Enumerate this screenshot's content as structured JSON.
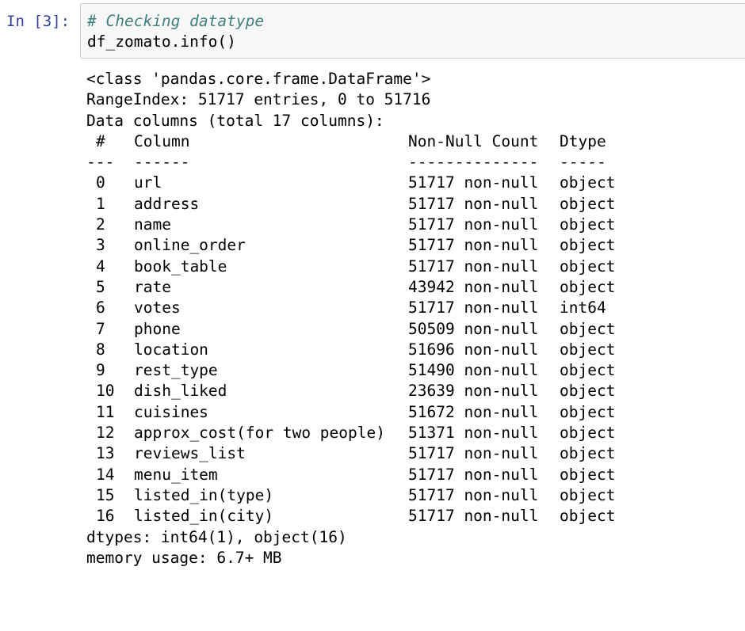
{
  "cell": {
    "prompt": "In [3]:",
    "code": {
      "comment": "# Checking datatype",
      "call": "df_zomato.info()"
    }
  },
  "output": {
    "class_line": "<class 'pandas.core.frame.DataFrame'>",
    "range_index": "RangeIndex: 51717 entries, 0 to 51716",
    "data_columns": "Data columns (total 17 columns):",
    "headers": {
      "index": "#",
      "column": "Column",
      "count": "Non-Null Count",
      "dtype": "Dtype"
    },
    "separators": {
      "index": "---",
      "column": "------",
      "count": "--------------",
      "dtype": "-----"
    },
    "rows": [
      {
        "index": "0",
        "column": "url",
        "count": "51717 non-null",
        "dtype": "object"
      },
      {
        "index": "1",
        "column": "address",
        "count": "51717 non-null",
        "dtype": "object"
      },
      {
        "index": "2",
        "column": "name",
        "count": "51717 non-null",
        "dtype": "object"
      },
      {
        "index": "3",
        "column": "online_order",
        "count": "51717 non-null",
        "dtype": "object"
      },
      {
        "index": "4",
        "column": "book_table",
        "count": "51717 non-null",
        "dtype": "object"
      },
      {
        "index": "5",
        "column": "rate",
        "count": "43942 non-null",
        "dtype": "object"
      },
      {
        "index": "6",
        "column": "votes",
        "count": "51717 non-null",
        "dtype": "int64"
      },
      {
        "index": "7",
        "column": "phone",
        "count": "50509 non-null",
        "dtype": "object"
      },
      {
        "index": "8",
        "column": "location",
        "count": "51696 non-null",
        "dtype": "object"
      },
      {
        "index": "9",
        "column": "rest_type",
        "count": "51490 non-null",
        "dtype": "object"
      },
      {
        "index": "10",
        "column": "dish_liked",
        "count": "23639 non-null",
        "dtype": "object"
      },
      {
        "index": "11",
        "column": "cuisines",
        "count": "51672 non-null",
        "dtype": "object"
      },
      {
        "index": "12",
        "column": "approx_cost(for two people)",
        "count": "51371 non-null",
        "dtype": "object"
      },
      {
        "index": "13",
        "column": "reviews_list",
        "count": "51717 non-null",
        "dtype": "object"
      },
      {
        "index": "14",
        "column": "menu_item",
        "count": "51717 non-null",
        "dtype": "object"
      },
      {
        "index": "15",
        "column": "listed_in(type)",
        "count": "51717 non-null",
        "dtype": "object"
      },
      {
        "index": "16",
        "column": "listed_in(city)",
        "count": "51717 non-null",
        "dtype": "object"
      }
    ],
    "dtypes_line": "dtypes: int64(1), object(16)",
    "memory_line": "memory usage: 6.7+ MB"
  },
  "colors": {
    "prompt": "#303f9f",
    "comment": "#408080",
    "input_bg": "#f7f7f7",
    "input_border": "#cfcfcf"
  }
}
